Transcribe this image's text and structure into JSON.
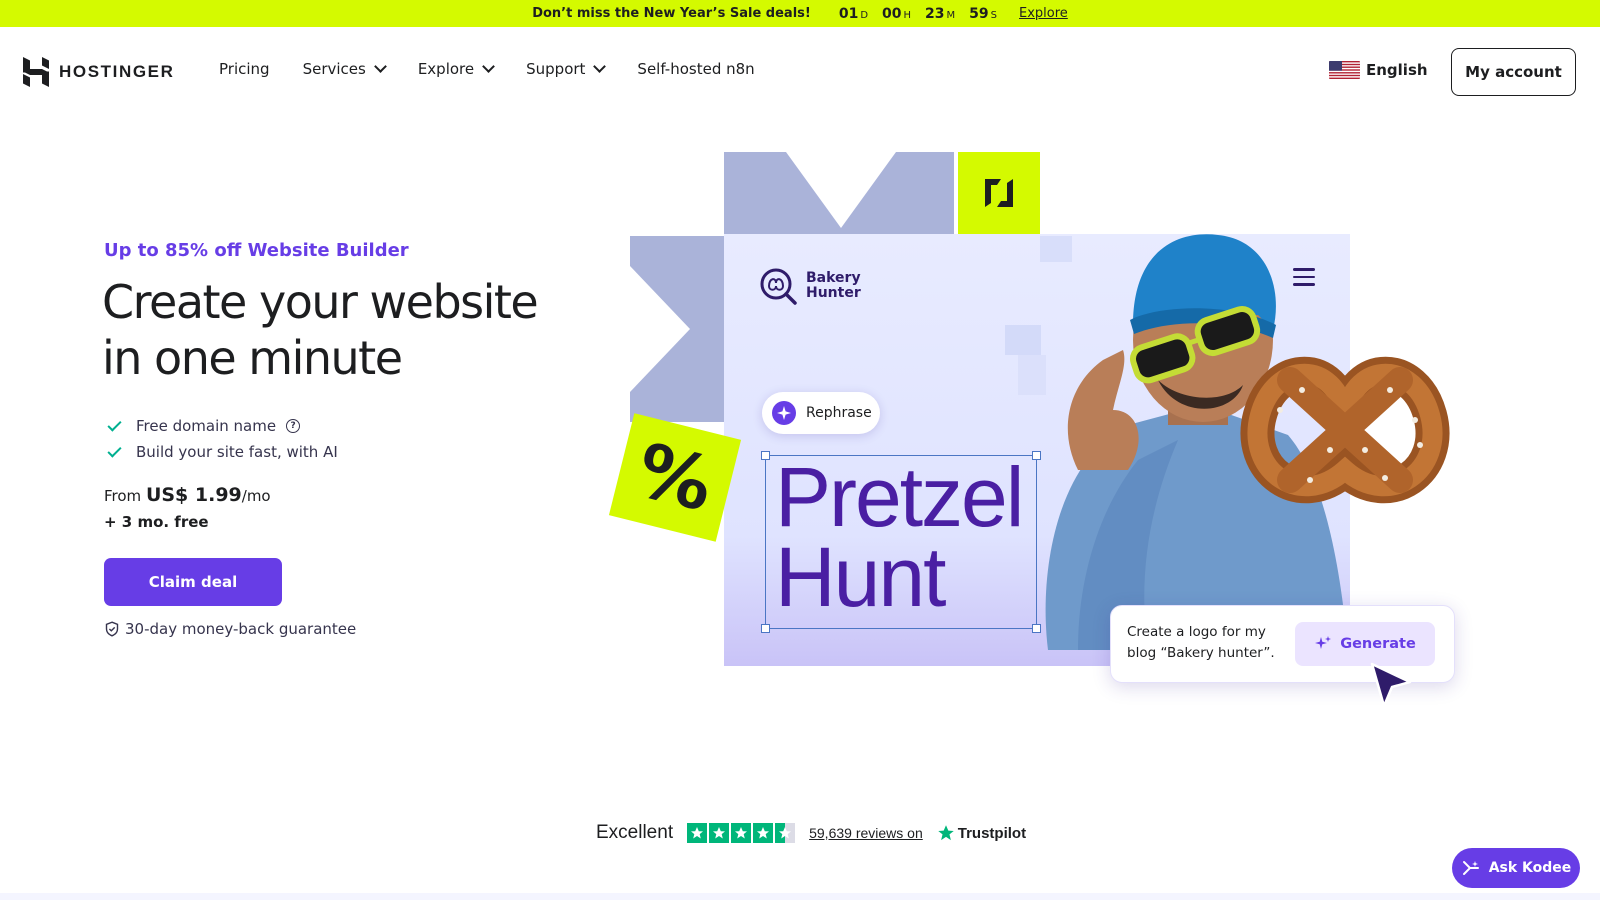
{
  "promo": {
    "message": "Don’t miss the New Year’s Sale deals!",
    "timer": [
      {
        "value": "01",
        "unit": "D"
      },
      {
        "value": "00",
        "unit": "H"
      },
      {
        "value": "23",
        "unit": "M"
      },
      {
        "value": "59",
        "unit": "S"
      }
    ],
    "link": "Explore"
  },
  "header": {
    "logo_text": "HOSTINGER",
    "nav": [
      {
        "label": "Pricing",
        "dropdown": false
      },
      {
        "label": "Services",
        "dropdown": true
      },
      {
        "label": "Explore",
        "dropdown": true
      },
      {
        "label": "Support",
        "dropdown": true
      },
      {
        "label": "Self-hosted n8n",
        "dropdown": false
      }
    ],
    "language": "English",
    "account_button": "My account"
  },
  "hero": {
    "eyebrow": "Up to 85% off Website Builder",
    "headline": "Create your website in one minute",
    "features": [
      "Free domain name",
      "Build your site fast, with AI"
    ],
    "price_prefix": "From ",
    "price_amount": "US$ 1.99",
    "price_suffix": "/mo",
    "bonus": "+ 3 mo. free",
    "cta": "Claim deal",
    "guarantee": "30-day money-back guarantee"
  },
  "illustration": {
    "brand_line1": "Bakery",
    "brand_line2": "Hunter",
    "rephrase": "Rephrase",
    "title_line1": "Pretzel",
    "title_line2": "Hunt",
    "percent": "%",
    "prompt_text": "Create a logo for my blog “Bakery hunter”.",
    "generate": "Generate"
  },
  "trustpilot": {
    "rating_word": "Excellent",
    "stars": 4.5,
    "reviews": "59,639 reviews on",
    "brand": "Trustpilot"
  },
  "assistant": {
    "label": "Ask Kodee"
  },
  "colors": {
    "accent": "#673de6",
    "lime": "#d4fa00",
    "trust_green": "#00b67a"
  }
}
